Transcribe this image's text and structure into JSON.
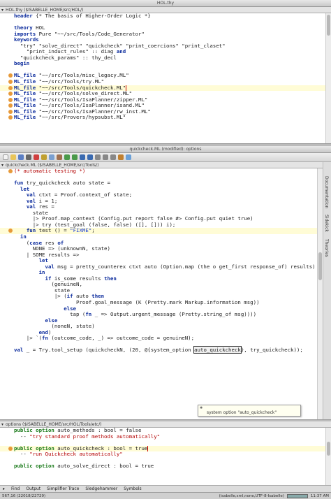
{
  "top_window": {
    "title": "HOL.thy",
    "path": "HOL.thy ($ISABELLE_HOME/src/HOL/)",
    "lines": [
      {
        "segs": [
          [
            "kw",
            "header"
          ],
          [
            "",
            " {* The basis of Higher-Order Logic *}"
          ]
        ]
      },
      {
        "segs": [
          [
            "",
            ""
          ]
        ]
      },
      {
        "segs": [
          [
            "kw",
            "theory"
          ],
          [
            "",
            " HOL"
          ]
        ]
      },
      {
        "segs": [
          [
            "kw",
            "imports"
          ],
          [
            "",
            " Pure \"~~/src/Tools/Code_Generator\""
          ]
        ]
      },
      {
        "segs": [
          [
            "kw",
            "keywords"
          ]
        ]
      },
      {
        "segs": [
          [
            "",
            "  \"try\" \"solve_direct\" \"quickcheck\" \"print_coercions\" \"print_claset\""
          ]
        ]
      },
      {
        "segs": [
          [
            "",
            "    \"print_induct_rules\" :: diag "
          ],
          [
            "kw",
            "and"
          ]
        ]
      },
      {
        "segs": [
          [
            "",
            "  \"quickcheck_params\" :: thy_decl"
          ]
        ]
      },
      {
        "segs": [
          [
            "kw",
            "begin"
          ]
        ]
      },
      {
        "segs": [
          [
            "",
            ""
          ]
        ]
      },
      {
        "segs": [
          [
            "kw",
            "ML_file"
          ],
          [
            "",
            " \"~~/src/Tools/misc_legacy.ML\""
          ]
        ],
        "mark": true
      },
      {
        "segs": [
          [
            "kw",
            "ML_file"
          ],
          [
            "",
            " \"~~/src/Tools/try.ML\""
          ]
        ],
        "mark": true
      },
      {
        "segs": [
          [
            "kw",
            "ML_file"
          ],
          [
            "",
            " \"~~/src/Tools/quickcheck.ML\""
          ]
        ],
        "mark": true,
        "hl": true,
        "cursor": true
      },
      {
        "segs": [
          [
            "kw",
            "ML_file"
          ],
          [
            "",
            " \"~~/src/Tools/solve_direct.ML\""
          ]
        ],
        "mark": true
      },
      {
        "segs": [
          [
            "kw",
            "ML_file"
          ],
          [
            "",
            " \"~~/src/Tools/IsaPlanner/zipper.ML\""
          ]
        ],
        "mark": true
      },
      {
        "segs": [
          [
            "kw",
            "ML_file"
          ],
          [
            "",
            " \"~~/src/Tools/IsaPlanner/isand.ML\""
          ]
        ],
        "mark": true
      },
      {
        "segs": [
          [
            "kw",
            "ML_file"
          ],
          [
            "",
            " \"~~/src/Tools/IsaPlanner/rw_inst.ML\""
          ]
        ],
        "mark": true
      },
      {
        "segs": [
          [
            "kw",
            "ML_file"
          ],
          [
            "",
            " \"~~/src/Provers/hypsubst.ML\""
          ]
        ],
        "mark": true
      }
    ]
  },
  "middle_window": {
    "title": "quickcheck.ML (modified): options",
    "path": "quickcheck.ML ($ISABELLE_HOME/src/Tools/)",
    "sidetabs": [
      "Documentation",
      "Sidekick",
      "Theories"
    ],
    "lines": [
      {
        "segs": [
          [
            "cmt",
            "(* automatic testing *)"
          ]
        ],
        "mark": true
      },
      {
        "segs": [
          [
            "",
            ""
          ]
        ]
      },
      {
        "segs": [
          [
            "kw",
            "fun"
          ],
          [
            "",
            " try_quickcheck auto state ="
          ]
        ]
      },
      {
        "segs": [
          [
            "",
            "  "
          ],
          [
            "kw",
            "let"
          ]
        ]
      },
      {
        "segs": [
          [
            "",
            "    "
          ],
          [
            "kw",
            "val"
          ],
          [
            "",
            " ctxt = Proof.context_of state;"
          ]
        ]
      },
      {
        "segs": [
          [
            "",
            "    "
          ],
          [
            "kw",
            "val"
          ],
          [
            "",
            " i = 1;"
          ]
        ]
      },
      {
        "segs": [
          [
            "",
            "    "
          ],
          [
            "kw",
            "val"
          ],
          [
            "",
            " res ="
          ]
        ]
      },
      {
        "segs": [
          [
            "",
            "      state"
          ]
        ]
      },
      {
        "segs": [
          [
            "",
            "      |> Proof.map_context (Config.put report false #> Config.put quiet true)"
          ]
        ]
      },
      {
        "segs": [
          [
            "",
            "      |> try (test_goal (false, false) ([], [])) i);"
          ]
        ]
      },
      {
        "segs": [
          [
            "",
            "    "
          ],
          [
            "kw",
            "fun"
          ],
          [
            "",
            " test () = "
          ],
          [
            "str",
            "\"FIXME\""
          ],
          [
            "",
            ";"
          ]
        ],
        "mark": true,
        "hl": true
      },
      {
        "segs": [
          [
            "",
            "  "
          ],
          [
            "kw",
            "in"
          ]
        ]
      },
      {
        "segs": [
          [
            "",
            "    ("
          ],
          [
            "kw",
            "case"
          ],
          [
            "",
            " res "
          ],
          [
            "kw",
            "of"
          ]
        ]
      },
      {
        "segs": [
          [
            "",
            "      NONE => (unknownN, state)"
          ]
        ]
      },
      {
        "segs": [
          [
            "",
            "    | SOME results =>"
          ]
        ]
      },
      {
        "segs": [
          [
            "",
            "        "
          ],
          [
            "kw",
            "let"
          ]
        ]
      },
      {
        "segs": [
          [
            "",
            "          "
          ],
          [
            "kw",
            "val"
          ],
          [
            "",
            " msg = pretty_counterex ctxt auto (Option.map (the o get_first response_of) results)"
          ]
        ]
      },
      {
        "segs": [
          [
            "",
            "        "
          ],
          [
            "kw",
            "in"
          ]
        ]
      },
      {
        "segs": [
          [
            "",
            "          "
          ],
          [
            "kw",
            "if"
          ],
          [
            "",
            " is_some results "
          ],
          [
            "kw",
            "then"
          ]
        ]
      },
      {
        "segs": [
          [
            "",
            "            (genuineN,"
          ]
        ]
      },
      {
        "segs": [
          [
            "",
            "             state"
          ]
        ]
      },
      {
        "segs": [
          [
            "",
            "             |> ("
          ],
          [
            "kw",
            "if"
          ],
          [
            "",
            " auto "
          ],
          [
            "kw",
            "then"
          ]
        ]
      },
      {
        "segs": [
          [
            "",
            "                    Proof.goal_message (K (Pretty.mark Markup.information msg))"
          ]
        ]
      },
      {
        "segs": [
          [
            "",
            "                "
          ],
          [
            "kw",
            "else"
          ]
        ]
      },
      {
        "segs": [
          [
            "",
            "                  tap ("
          ],
          [
            "kw",
            "fn"
          ],
          [
            "",
            " _ => Output.urgent_message (Pretty.string_of msg))))"
          ]
        ]
      },
      {
        "segs": [
          [
            "",
            "          "
          ],
          [
            "kw",
            "else"
          ]
        ]
      },
      {
        "segs": [
          [
            "",
            "            (noneN, state)"
          ]
        ]
      },
      {
        "segs": [
          [
            "",
            "        "
          ],
          [
            "kw",
            "end"
          ],
          [
            "",
            ")"
          ]
        ]
      },
      {
        "segs": [
          [
            "",
            "    |> `("
          ],
          [
            "kw",
            "fn"
          ],
          [
            "",
            " (outcome_code, _) => outcome_code = genuineN);"
          ]
        ]
      },
      {
        "segs": [
          [
            "",
            ""
          ]
        ]
      },
      {
        "segs": [
          [
            "kw",
            "val"
          ],
          [
            "",
            " _ = Try.tool_setup (quickcheckN, (20, @{system_option "
          ],
          [
            "boxed",
            "auto_quickcheck"
          ],
          [
            "",
            "}, try_quickcheck));"
          ]
        ]
      }
    ],
    "popup_text": "system option \"auto_quickcheck\""
  },
  "bottom_window": {
    "path": "options ($ISABELLE_HOME/src/HOL/Tools/etc/)",
    "lines": [
      {
        "segs": [
          [
            "kw2",
            "public"
          ],
          [
            "",
            " "
          ],
          [
            "kw2",
            "option"
          ],
          [
            "",
            " auto_methods : bool = false"
          ]
        ]
      },
      {
        "segs": [
          [
            "",
            "  -- "
          ],
          [
            "cmt",
            "\"try standard proof methods automatically\""
          ]
        ]
      },
      {
        "segs": [
          [
            "",
            ""
          ]
        ]
      },
      {
        "segs": [
          [
            "kw2",
            "public"
          ],
          [
            "",
            " "
          ],
          [
            "kw2",
            "option"
          ],
          [
            "",
            " auto_quickcheck : bool = true"
          ]
        ],
        "mark": true,
        "hl": true,
        "cursor": true
      },
      {
        "segs": [
          [
            "",
            "  -- "
          ],
          [
            "cmt",
            "\"run Quickcheck automatically\""
          ]
        ]
      },
      {
        "segs": [
          [
            "",
            ""
          ]
        ]
      },
      {
        "segs": [
          [
            "kw2",
            "public"
          ],
          [
            "",
            " "
          ],
          [
            "kw2",
            "option"
          ],
          [
            "",
            " auto_solve_direct : bool = true"
          ]
        ]
      }
    ]
  },
  "bottom_tabs": [
    "Find",
    "Output",
    "Simplifier Trace",
    "Sledgehammer",
    "Symbols"
  ],
  "status": {
    "left": "567,16 (22018/22729)",
    "right": "(isabelle,sml,none,UTF-8-Isabelle)",
    "memory": "11:37 AM"
  }
}
